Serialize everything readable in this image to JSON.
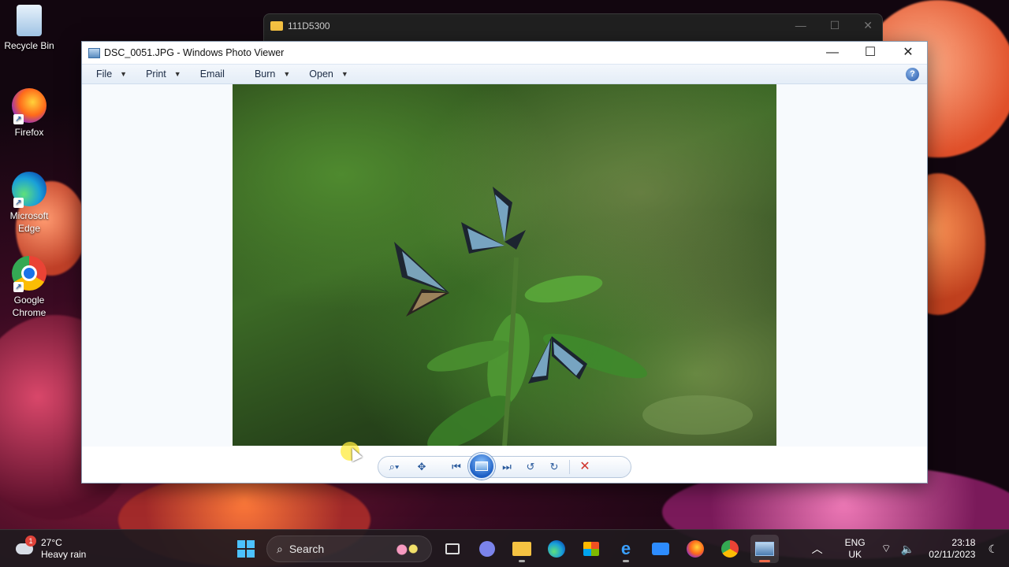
{
  "desktop": {
    "icons": [
      {
        "label": "Recycle Bin"
      },
      {
        "label": "Firefox"
      },
      {
        "label": "Microsoft Edge"
      },
      {
        "label": "Google Chrome"
      }
    ]
  },
  "explorer": {
    "title": "111D5300"
  },
  "viewer": {
    "title": "DSC_0051.JPG - Windows Photo Viewer",
    "menu": [
      {
        "label": "File",
        "has_dropdown": true
      },
      {
        "label": "Print",
        "has_dropdown": true
      },
      {
        "label": "Email",
        "has_dropdown": false
      },
      {
        "label": "Burn",
        "has_dropdown": true
      },
      {
        "label": "Open",
        "has_dropdown": true
      }
    ],
    "help_glyph": "?",
    "controls": [
      "zoom-icon",
      "actual-size-icon",
      "previous-icon",
      "slideshow-icon",
      "next-icon",
      "rotate-left-icon",
      "rotate-right-icon",
      "delete-icon"
    ]
  },
  "taskbar": {
    "weather": {
      "temp": "27°C",
      "condition": "Heavy rain",
      "badge": "1"
    },
    "search_placeholder": "Search",
    "language": {
      "line1": "ENG",
      "line2": "UK"
    },
    "clock": {
      "time": "23:18",
      "date": "02/11/2023"
    }
  }
}
